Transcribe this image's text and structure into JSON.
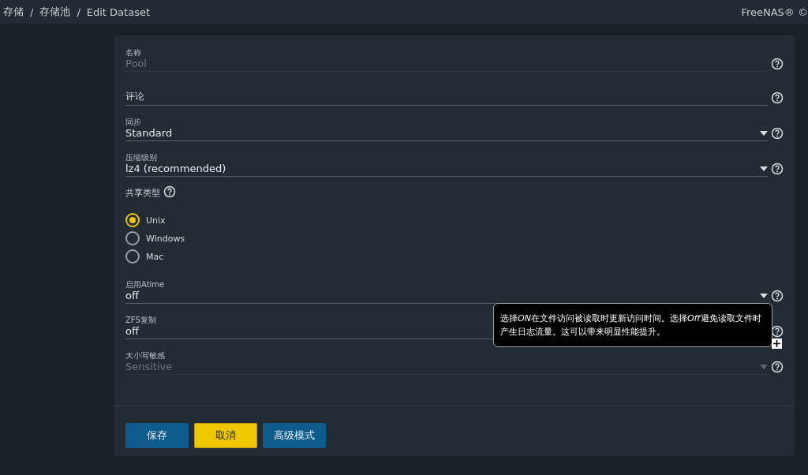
{
  "breadcrumb": [
    "存储",
    "存储池",
    "Edit Dataset"
  ],
  "breadcrumb_separator": "/",
  "brand": "FreeNAS® ©",
  "fields": [
    {
      "kind": "text",
      "label": "名称",
      "value": "Pool",
      "disabled": true
    },
    {
      "kind": "text",
      "placeholder": "评论",
      "disabled": false
    },
    {
      "kind": "select",
      "label": "同步",
      "value": "Standard",
      "disabled": false
    },
    {
      "kind": "select",
      "label": "压缩级别",
      "value": "lz4 (recommended)",
      "disabled": false
    },
    {
      "kind": "radio",
      "label": "共享类型",
      "options": [
        {
          "label": "Unix",
          "selected": true
        },
        {
          "label": "Windows",
          "selected": false
        },
        {
          "label": "Mac",
          "selected": false
        }
      ]
    },
    {
      "kind": "select",
      "label": "启用Atime",
      "value": "off",
      "disabled": false
    },
    {
      "kind": "select",
      "label": "ZFS复制",
      "value": "off",
      "disabled": false
    },
    {
      "kind": "select",
      "label": "大小写敏感",
      "value": "Sensitive",
      "disabled": true
    }
  ],
  "tooltip": [
    {
      "text": "选择",
      "italic": false
    },
    {
      "text": "ON",
      "italic": true
    },
    {
      "text": "在文件访问被读取时更新访问时间。选择",
      "italic": false
    },
    {
      "text": "Off",
      "italic": true
    },
    {
      "text": "避免读取文件时产生日志流量。这可以带来明显性能提升。",
      "italic": false
    }
  ],
  "buttons": [
    {
      "label": "保存",
      "kind": "primary"
    },
    {
      "label": "取消",
      "kind": "warn"
    },
    {
      "label": "高级模式",
      "kind": "primary"
    }
  ]
}
